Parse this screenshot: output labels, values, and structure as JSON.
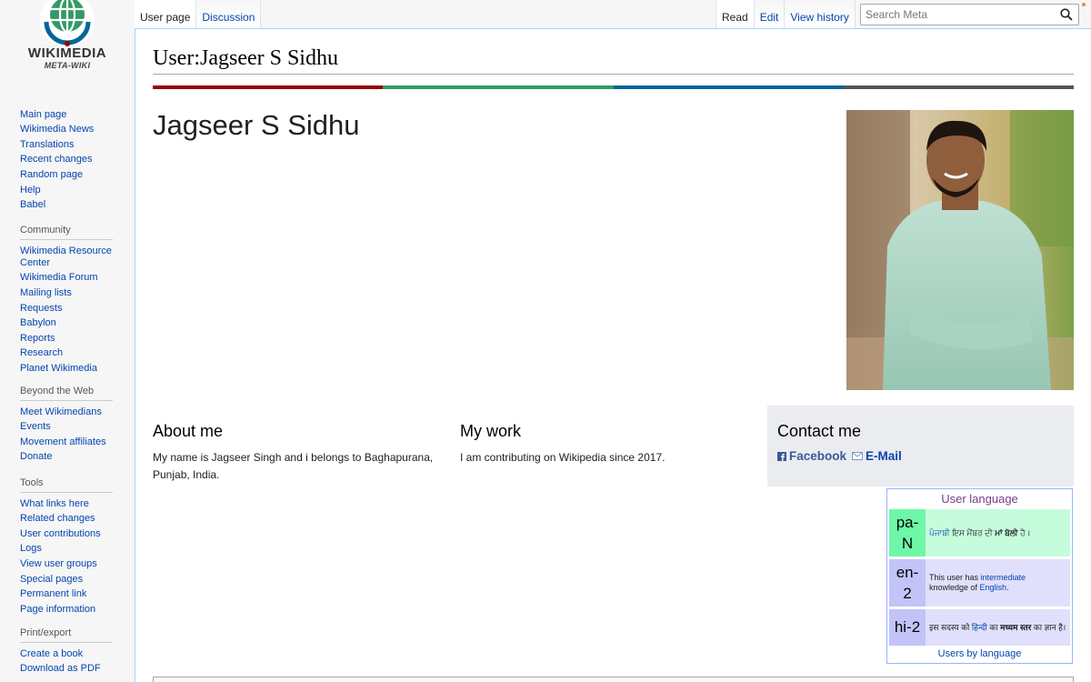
{
  "logo": {
    "name": "WIKIMEDIA",
    "subtitle": "META-WIKI"
  },
  "sidebar": {
    "navigation": [
      "Main page",
      "Wikimedia News",
      "Translations",
      "Recent changes",
      "Random page",
      "Help",
      "Babel"
    ],
    "community": {
      "heading": "Community",
      "items": [
        "Wikimedia Resource Center",
        "Wikimedia Forum",
        "Mailing lists",
        "Requests",
        "Babylon",
        "Reports",
        "Research",
        "Planet Wikimedia"
      ]
    },
    "beyond": {
      "heading": "Beyond the Web",
      "items": [
        "Meet Wikimedians",
        "Events",
        "Movement affiliates",
        "Donate"
      ]
    },
    "tools": {
      "heading": "Tools",
      "items": [
        "What links here",
        "Related changes",
        "User contributions",
        "Logs",
        "View user groups",
        "Special pages",
        "Permanent link",
        "Page information"
      ]
    },
    "print": {
      "heading": "Print/export",
      "items": [
        "Create a book",
        "Download as PDF"
      ]
    }
  },
  "tabs": {
    "user_page": "User page",
    "discussion": "Discussion",
    "read": "Read",
    "edit": "Edit",
    "history": "View history"
  },
  "search": {
    "placeholder": "Search Meta",
    "value": ""
  },
  "page": {
    "title": "User:Jagseer S Sidhu",
    "name": "Jagseer S Sidhu",
    "colorbar": [
      "#990000",
      "#339966",
      "#006699",
      "#555555"
    ]
  },
  "sections": {
    "about": {
      "heading": "About me",
      "text": "My name is Jagseer Singh and i belongs to Baghapurana, Punjab, India."
    },
    "work": {
      "heading": "My work",
      "text": "I am contributing on Wikipedia since 2017."
    },
    "contact": {
      "heading": "Contact me",
      "facebook": "Facebook",
      "email": "E-Mail"
    }
  },
  "babel": {
    "title": "User language",
    "rows": [
      {
        "code": "pa-N",
        "color_code": "#6ef7a7",
        "color_desc": "#c5fcdc",
        "link": "ਪੰਜਾਬੀ",
        "text1": " ਇਸ ਮੈਂਬਰ ਦੀ ",
        "bold": "ਮਾਂ ਬੋਲੀ",
        "text2": " ਹੈ।"
      },
      {
        "code": "en-2",
        "color_code": "#c3c3f7",
        "color_desc": "#e0e0fc",
        "pre": "This user has ",
        "link1": "intermediate",
        "mid": " knowledge of ",
        "link2": "English",
        "post": "."
      },
      {
        "code": "hi-2",
        "color_code": "#c3c3f7",
        "color_desc": "#e0e0fc",
        "pre": "इस सदस्य को ",
        "link": "हिन्दी",
        "mid": " का ",
        "bold": "मध्यम स्तर",
        "post": " का ज्ञान है।"
      }
    ],
    "footer": "Users by language"
  }
}
